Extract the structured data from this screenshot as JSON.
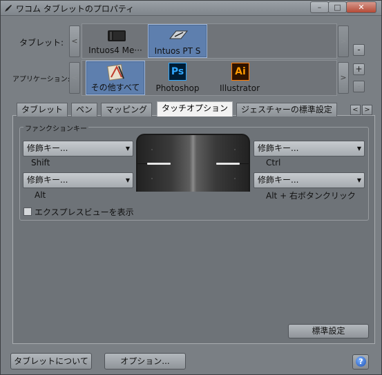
{
  "window": {
    "title": "ワコム タブレットのプロパティ",
    "controls": {
      "minimize": "–",
      "maximize": "□",
      "close": "✕"
    }
  },
  "devices": {
    "label": "タブレット:",
    "nav_prev": "<",
    "nav_next": ">",
    "remove": "-",
    "items": [
      {
        "label": "Intuos4 Me···",
        "icon": "tablet-dark-icon",
        "selected": false
      },
      {
        "label": "Intuos PT S",
        "icon": "tablet-pen-icon",
        "selected": true
      }
    ]
  },
  "applications": {
    "label": "アプリケーション:",
    "nav_prev": "<",
    "nav_next": ">",
    "add": "+",
    "remove": "-",
    "items": [
      {
        "label": "その他すべて",
        "icon": "all-apps-icon",
        "selected": true
      },
      {
        "label": "Photoshop",
        "icon": "photoshop-icon",
        "icon_text": "Ps",
        "selected": false
      },
      {
        "label": "Illustrator",
        "icon": "illustrator-icon",
        "icon_text": "Ai",
        "selected": false
      }
    ]
  },
  "tabs": [
    {
      "label": "タブレット",
      "active": false
    },
    {
      "label": "ペン",
      "active": false
    },
    {
      "label": "マッピング",
      "active": false
    },
    {
      "label": "タッチオプション",
      "active": true
    },
    {
      "label": "ジェスチャーの標準設定",
      "active": false
    }
  ],
  "tab_nav": {
    "prev": "<",
    "next": ">"
  },
  "function_keys": {
    "title": "ファンクションキー",
    "keys": [
      {
        "dropdown": "修飾キー...",
        "label": "Shift"
      },
      {
        "dropdown": "修飾キー...",
        "label": "Alt"
      },
      {
        "dropdown": "修飾キー...",
        "label": "Ctrl"
      },
      {
        "dropdown": "修飾キー...",
        "label": "Alt + 右ボタンクリック"
      }
    ]
  },
  "express_view": {
    "label": "エクスプレスビューを表示",
    "checked": false
  },
  "buttons": {
    "default": "標準設定",
    "about": "タブレットについて",
    "options": "オプション...",
    "help": "?"
  },
  "colors": {
    "selection": "#5e7fae",
    "panel": "#6e7378",
    "active_tab": "#f2f2f2",
    "photoshop": "#001d34",
    "illustrator": "#2e1300"
  }
}
